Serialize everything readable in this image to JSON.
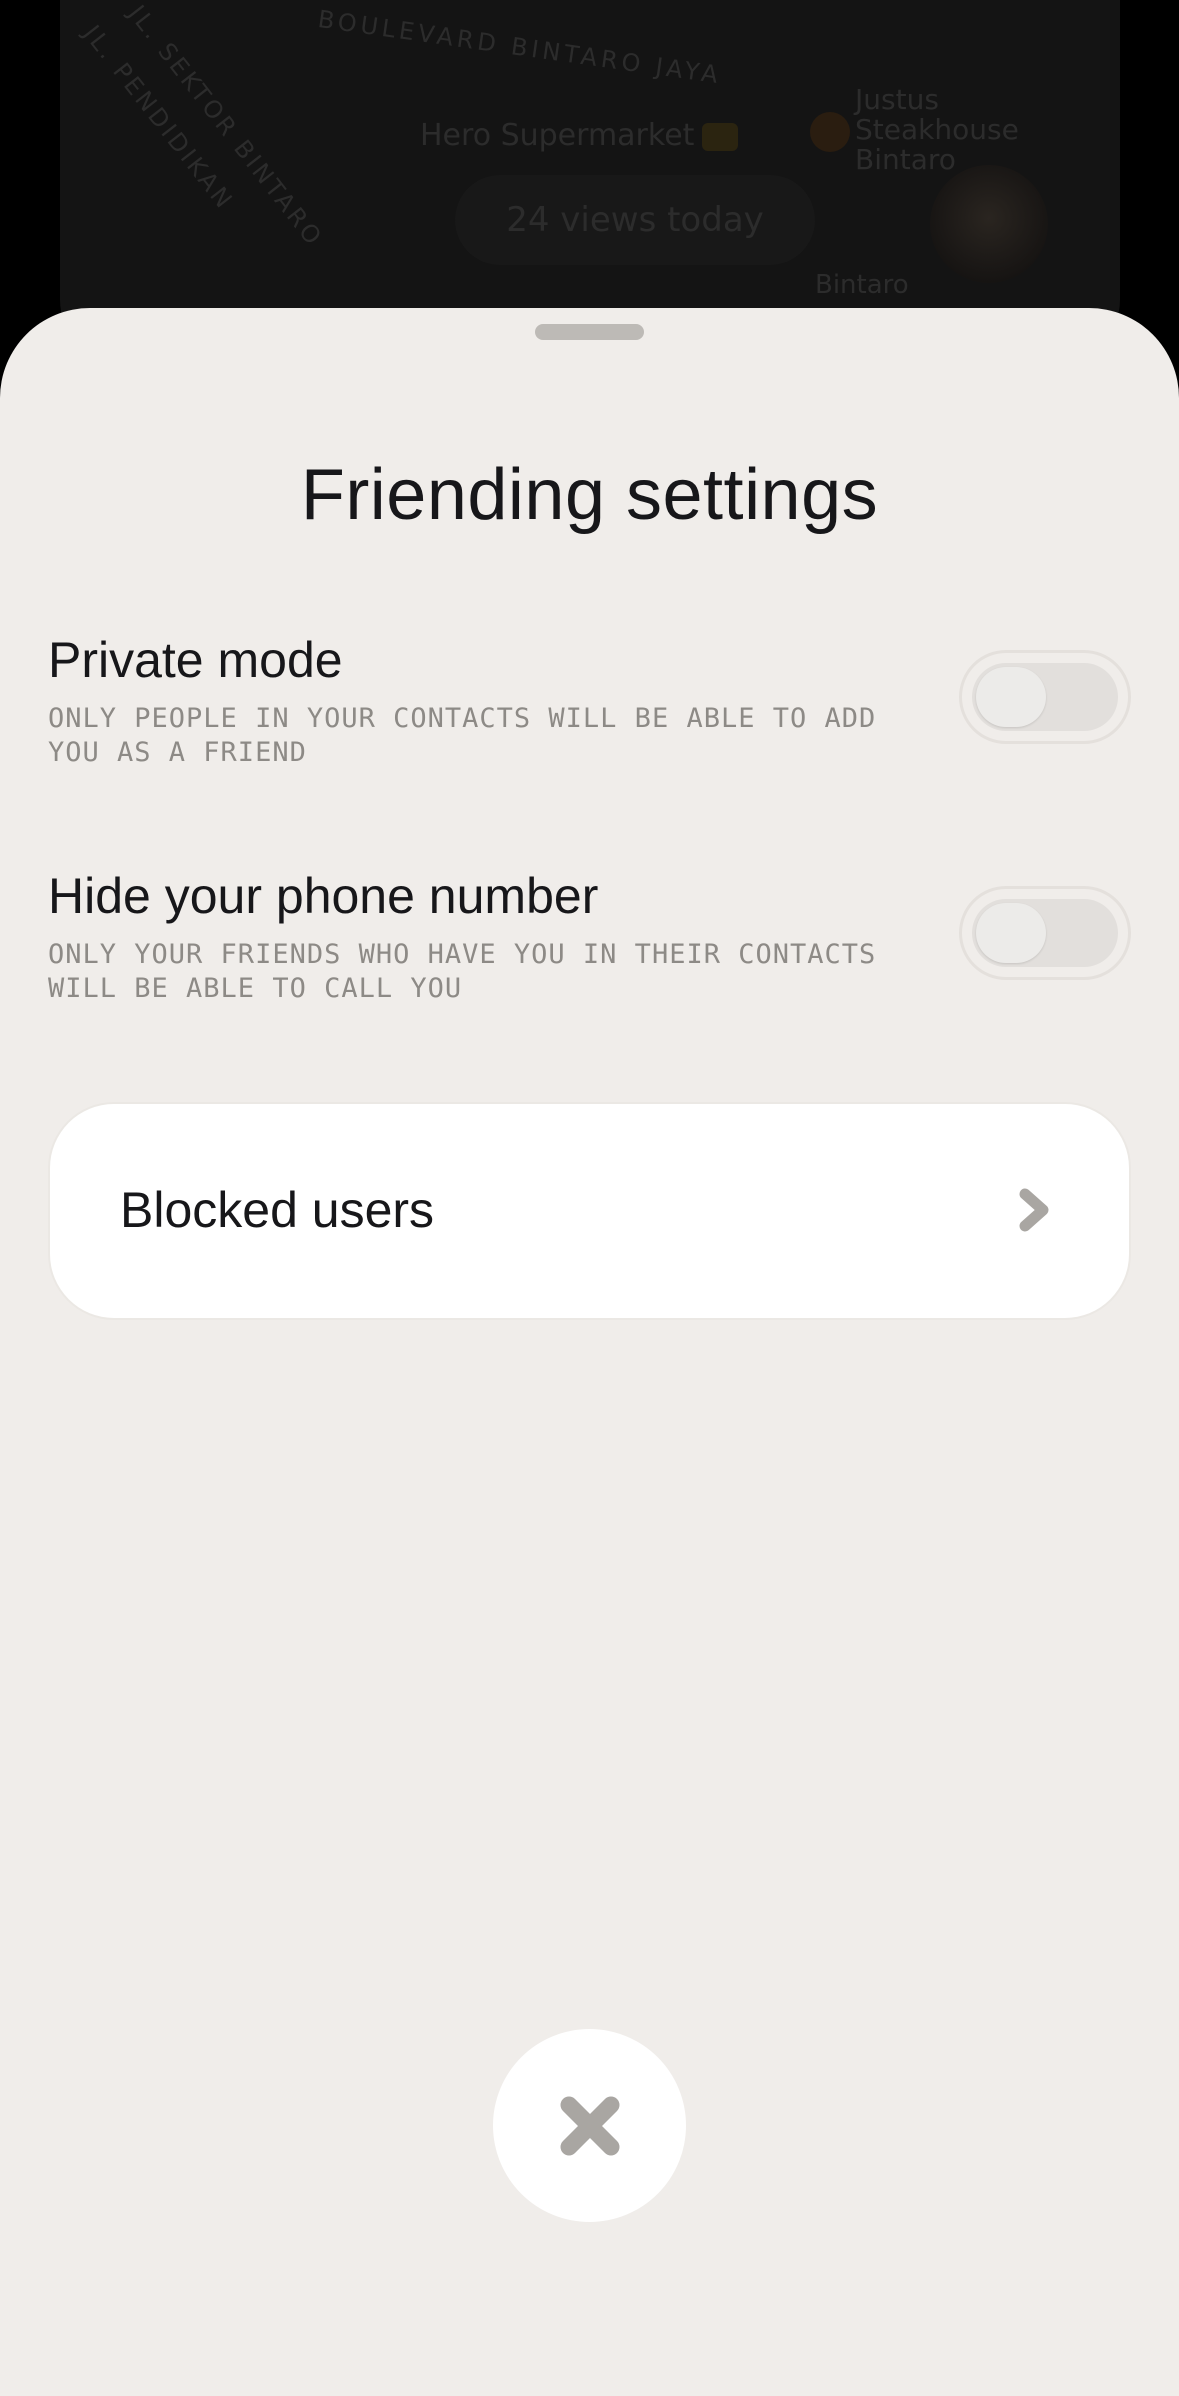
{
  "background": {
    "map_labels": {
      "road_1": "JL. PENDIDIKAN",
      "road_2": "JL. SEKTOR BINTARO",
      "road_3": "BOULEVARD BINTARO JAYA",
      "place_1": "Hero Supermarket",
      "place_2": "Justus Steakhouse Bintaro",
      "place_3": "Bintaro"
    },
    "views_pill": "24 views today"
  },
  "sheet": {
    "title": "Friending settings",
    "settings": [
      {
        "label": "Private mode",
        "description": "ONLY PEOPLE IN YOUR CONTACTS WILL BE ABLE TO ADD YOU AS A FRIEND",
        "enabled": false
      },
      {
        "label": "Hide your phone number",
        "description": "ONLY YOUR FRIENDS WHO HAVE YOU IN THEIR CONTACTS WILL BE ABLE TO CALL YOU",
        "enabled": false
      }
    ],
    "blocked_users_label": "Blocked users"
  },
  "icons": {
    "chevron": "chevron-right-icon",
    "close": "close-icon"
  },
  "colors": {
    "sheet_background": "#f0edea",
    "text_primary": "#17171a",
    "text_secondary": "#8d8a86",
    "icon_gray": "#a9a6a2"
  }
}
